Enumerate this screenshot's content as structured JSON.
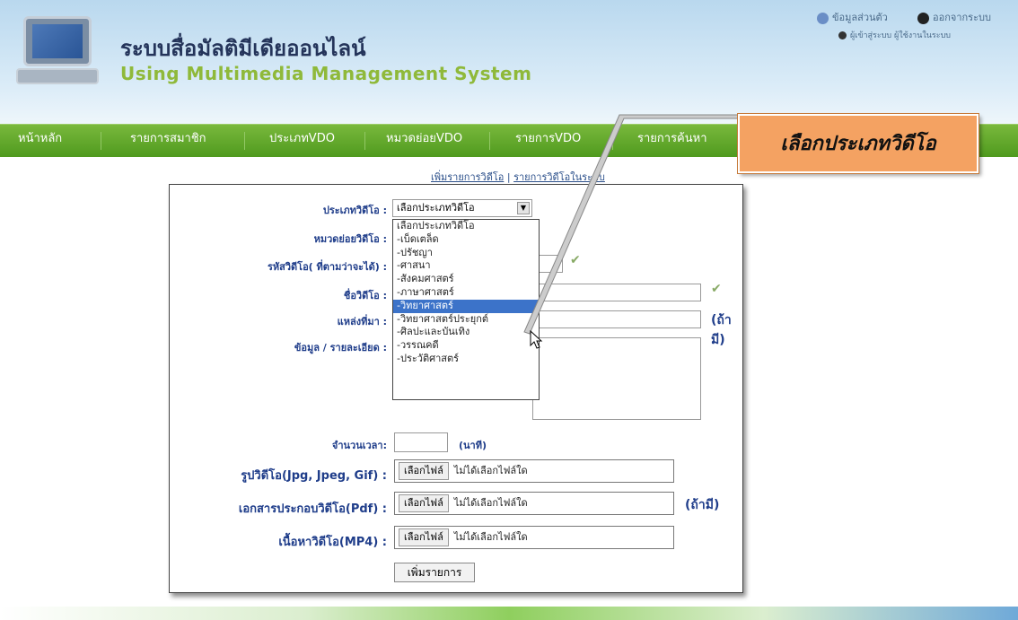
{
  "header": {
    "title_th": "ระบบสื่อมัลติมีเดียออนไลน์",
    "title_en": "Using Multimedia Management System",
    "top_links": {
      "profile": "ข้อมูลส่วนตัว",
      "logout": "ออกจากระบบ",
      "user_status": "ผู้เข้าสู่ระบบ ผู้ใช้งานในระบบ"
    }
  },
  "nav": {
    "items": [
      "หน้าหลัก",
      "รายการสมาชิก",
      "ประเภทVDO",
      "หมวดย่อยVDO",
      "รายการVDO",
      "รายการค้นหา"
    ]
  },
  "subnav": {
    "add": "เพิ่มรายการวิดีโอ",
    "separator": "|",
    "list": "รายการวิดีโอในระบบ"
  },
  "form": {
    "labels": {
      "type": "ประเภทวิดีโอ :",
      "subcategory": "หมวดย่อยวิดีโอ :",
      "code": "รหัสวิดีโอ( ที่ตามว่าจะได้) :",
      "name": "ชื่อวิดีโอ :",
      "source": "แหล่งที่มา :",
      "detail": "ข้อมูล / รายละเอียด :",
      "duration": "จำนวนเวลา:",
      "image": "รูปวิดีโอ(Jpg, Jpeg, Gif) :",
      "document": "เอกสารประกอบวิดีโอ(Pdf) :",
      "content": "เนื้อหาวิดีโอ(MP4) :"
    },
    "type_select_value": "เลือกประเภทวิดีโอ",
    "dropdown_options": [
      "เลือกประเภทวิดีโอ",
      "-เบ็ดเตล็ด",
      "-ปรัชญา",
      "-ศาสนา",
      "-สังคมศาสตร์",
      "-ภาษาศาสตร์",
      "-วิทยาศาสตร์",
      "-วิทยาศาสตร์ประยุกต์",
      "-ศิลปะและบันเทิง",
      "-วรรณคดี",
      "-ประวัติศาสตร์"
    ],
    "selected_option": "-วิทยาศาสตร์",
    "optional_hint": "(ถ้ามี)",
    "duration_unit": "(นาที)",
    "file_button": "เลือกไฟล์",
    "file_none": "ไม่ได้เลือกไฟล์ใด",
    "submit": "เพิ่มรายการ"
  },
  "callout": {
    "text": "เลือกประเภทวิดีโอ"
  },
  "colors": {
    "nav_green": "#5fa52a",
    "label_blue": "#1f3d8a",
    "callout_orange": "#f4a262",
    "selection_blue": "#3c73c9"
  }
}
